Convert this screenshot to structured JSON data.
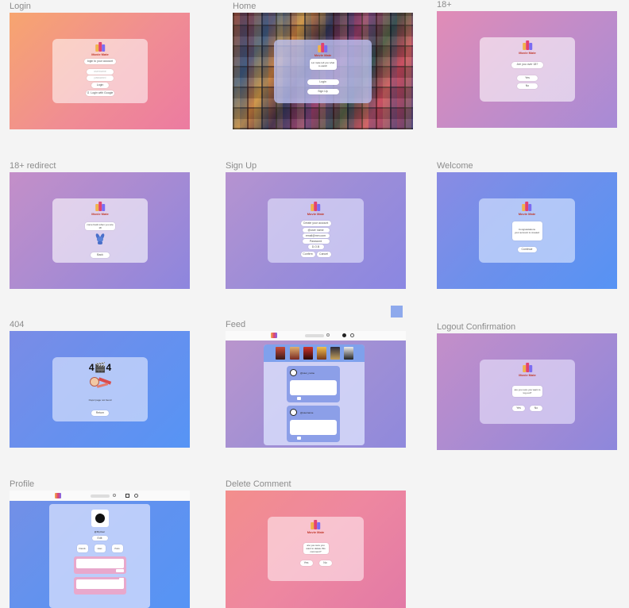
{
  "frames": {
    "login": {
      "label": "Login",
      "gradient": [
        "#f6a47a",
        "#ec7fa0"
      ],
      "brand": "Movie Mate",
      "fields": [
        "login",
        "Login with Google"
      ]
    },
    "home": {
      "label": "Home",
      "buttons": [
        "Login",
        "Sign Up"
      ]
    },
    "age_gate": {
      "label": "18+",
      "gradient": [
        "#d88fc0",
        "#a88ad6"
      ],
      "brand": "Movie Mate",
      "options": [
        "Yes",
        "No"
      ]
    },
    "age_redirect": {
      "label": "18+ redirect",
      "gradient": [
        "#c692c8",
        "#9b86d8"
      ],
      "brand": "Movie Mate"
    },
    "signup": {
      "label": "Sign Up",
      "gradient": [
        "#b590d0",
        "#8f87e0"
      ],
      "brand": "Movie Mate",
      "buttons": [
        "Confirm",
        "Cancel"
      ]
    },
    "welcome": {
      "label": "Welcome",
      "gradient": [
        "#7d8fe6",
        "#5b92f2"
      ],
      "brand": "Movie Mate",
      "buttons": [
        "Continue"
      ]
    },
    "not_found": {
      "label": "404",
      "gradient": [
        "#6f8ee8",
        "#5b93f3"
      ],
      "code": "4🎬4"
    },
    "feed": {
      "label": "Feed",
      "gradient": [
        "#b995cd",
        "#8f88da"
      ]
    },
    "logout": {
      "label": "Logout Confirmation",
      "gradient": [
        "#c08fcb",
        "#9489d9"
      ],
      "brand": "Movie Mate",
      "buttons": [
        "Yes",
        "No"
      ]
    },
    "profile": {
      "label": "Profile",
      "gradient": [
        "#6f8ee8",
        "#5b94f4"
      ]
    },
    "delete_comment": {
      "label": "Delete Comment",
      "gradient": [
        "#f08f9a",
        "#e37aa5"
      ],
      "brand": "Movie Mate",
      "buttons": [
        "Yes",
        "No"
      ]
    }
  }
}
